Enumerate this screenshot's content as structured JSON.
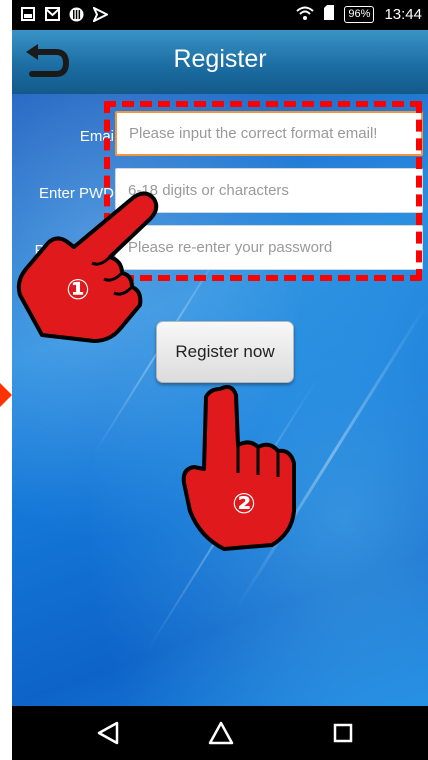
{
  "status_bar": {
    "battery": "96%",
    "time": "13:44",
    "icons_left": [
      "picture-icon",
      "mail-icon",
      "voicemail-icon",
      "notification-icon"
    ],
    "icons_right": [
      "wifi-icon",
      "sim-icon",
      "battery-icon"
    ]
  },
  "header": {
    "title": "Register"
  },
  "form": {
    "email_label": "Emai",
    "email_placeholder": "Please input the correct format email!",
    "pwd_label": "Enter PWD",
    "pwd_placeholder": "6-18 digits or characters",
    "confirm_label": "Pl",
    "confirm_placeholder": "Please re-enter your password"
  },
  "register_button": "Register now",
  "annotations": {
    "step1": "①",
    "step2": "②"
  },
  "colors": {
    "title_bar": "#1c6ea3",
    "highlight": "#ff0000",
    "focus_border": "#f0963c"
  }
}
